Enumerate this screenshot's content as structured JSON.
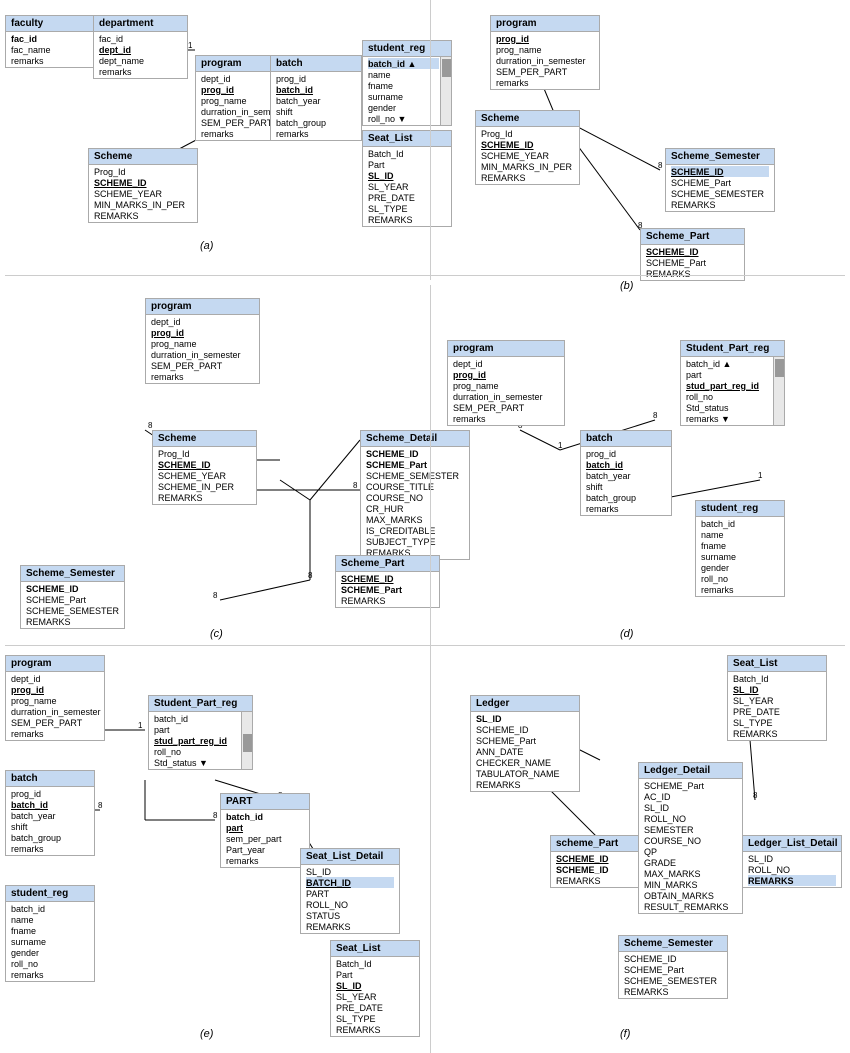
{
  "diagrams": {
    "a_label": "(a)",
    "b_label": "(b)",
    "c_label": "(c)",
    "d_label": "(d)",
    "e_label": "(e)",
    "f_label": "(f)"
  },
  "tables": {
    "faculty": {
      "header": "faculty",
      "fields": [
        "fac_id",
        "fac_name",
        "remarks"
      ]
    },
    "department_a": {
      "header": "department",
      "fields": [
        "fac_id",
        "dept_id",
        "dept_name",
        "remarks"
      ]
    },
    "program_a": {
      "header": "program",
      "fields": [
        "dept_id",
        "prog_id",
        "prog_name",
        "durration_in_semester",
        "SEM_PER_PART",
        "remarks"
      ]
    },
    "batch_a": {
      "header": "batch",
      "fields": [
        "prog_id",
        "batch_id",
        "batch_year",
        "shift",
        "batch_group",
        "remarks"
      ]
    },
    "scheme_a": {
      "header": "Scheme",
      "fields": [
        "Prog_Id",
        "SCHEME_ID",
        "SCHEME_YEAR",
        "MIN_MARKS_IN_PER",
        "REMARKS"
      ]
    },
    "student_reg_a": {
      "header": "student_reg",
      "fields": [
        "batch_id",
        "name",
        "fname",
        "surname",
        "gender",
        "roll_no"
      ]
    },
    "seat_list_a": {
      "header": "Seat_List",
      "fields": [
        "Batch_Id",
        "Part",
        "SL_ID",
        "SL_YEAR",
        "PRE_DATE",
        "SL_TYPE",
        "REMARKS"
      ]
    },
    "program_b": {
      "header": "program",
      "fields": [
        "prog_id",
        "prog_name",
        "durration_in_semester",
        "SEM_PER_PART",
        "remarks"
      ]
    },
    "scheme_b": {
      "header": "Scheme",
      "fields": [
        "Prog_Id",
        "SCHEME_ID",
        "SCHEME_YEAR",
        "MIN_MARKS_IN_PER",
        "REMARKS"
      ]
    },
    "scheme_part_b": {
      "header": "Scheme_Part",
      "fields": [
        "SCHEME_ID",
        "SCHEME_Part",
        "REMARKS"
      ]
    },
    "scheme_semester_b": {
      "header": "Scheme_Semester",
      "fields": [
        "SCHEME_ID",
        "SCHEME_Part",
        "SCHEME_SEMESTER",
        "REMARKS"
      ]
    },
    "program_c": {
      "header": "program",
      "fields": [
        "dept_id",
        "prog_id",
        "prog_name",
        "durration_in_semester",
        "SEM_PER_PART",
        "remarks"
      ]
    },
    "scheme_c": {
      "header": "Scheme",
      "fields": [
        "Prog_Id",
        "SCHEME_ID",
        "SCHEME_YEAR",
        "SCHEME_IN_PER",
        "REMARKS"
      ]
    },
    "scheme_detail_c": {
      "header": "Scheme_Detail",
      "fields": [
        "SCHEME_ID",
        "SCHEME_Part",
        "SCHEME_SEMESTER",
        "COURSE_TITLE",
        "COURSE_NO",
        "CR_HUR",
        "MAX_MARKS",
        "IS_CREDITABLE",
        "SUBJECT_TYPE",
        "REMARKS"
      ]
    },
    "scheme_part_c": {
      "header": "Scheme_Part",
      "fields": [
        "SCHEME_ID",
        "SCHEME_Part",
        "REMARKS"
      ]
    },
    "scheme_semester_c": {
      "header": "Scheme_Semester",
      "fields": [
        "SCHEME_ID",
        "SCHEME_Part",
        "SCHEME_SEMESTER",
        "REMARKS"
      ]
    },
    "program_d": {
      "header": "program",
      "fields": [
        "dept_id",
        "prog_id",
        "prog_name",
        "durration_in_semester",
        "SEM_PER_PART",
        "remarks"
      ]
    },
    "batch_d": {
      "header": "batch",
      "fields": [
        "prog_id",
        "batch_id",
        "batch_year",
        "shift",
        "batch_group",
        "remarks"
      ]
    },
    "student_part_reg_d": {
      "header": "Student_Part_reg",
      "fields": [
        "batch_id",
        "part",
        "stud_part_reg_id",
        "roll_no",
        "Std_status",
        "remarks"
      ]
    },
    "student_reg_d": {
      "header": "student_reg",
      "fields": [
        "batch_id",
        "name",
        "fname",
        "surname",
        "gender",
        "roll_no",
        "remarks"
      ]
    },
    "program_e": {
      "header": "program",
      "fields": [
        "dept_id",
        "prog_id",
        "prog_name",
        "durration_in_semester",
        "SEM_PER_PART",
        "remarks"
      ]
    },
    "batch_e": {
      "header": "batch",
      "fields": [
        "prog_id",
        "batch_id",
        "batch_year",
        "shift",
        "batch_group",
        "remarks"
      ]
    },
    "student_reg_e": {
      "header": "student_reg",
      "fields": [
        "batch_id",
        "name",
        "fname",
        "surname",
        "gender",
        "roll_no",
        "remarks"
      ]
    },
    "student_part_reg_e": {
      "header": "Student_Part_reg",
      "fields": [
        "batch_id",
        "part",
        "stud_part_reg_id",
        "roll_no",
        "Std_status"
      ]
    },
    "part_e": {
      "header": "PART",
      "fields": [
        "batch_id",
        "part",
        "sem_per_part",
        "Part_year",
        "remarks"
      ]
    },
    "seat_list_detail_e": {
      "header": "Seat_List_Detail",
      "fields": [
        "SL_ID",
        "BATCH_ID",
        "PART",
        "ROLL_NO",
        "STATUS",
        "REMARKS"
      ]
    },
    "seat_list_e": {
      "header": "Seat_List",
      "fields": [
        "Batch_Id",
        "Part",
        "SL_ID",
        "SL_YEAR",
        "PRE_DATE",
        "SL_TYPE",
        "REMARKS"
      ]
    },
    "ledger_f": {
      "header": "Ledger",
      "fields": [
        "SL_ID",
        "SCHEME_ID",
        "SCHEME_Part",
        "ANN_DATE",
        "CHECKER_NAME",
        "TABULATOR_NAME",
        "REMARKS"
      ]
    },
    "scheme_part_f": {
      "header": "scheme_Part",
      "fields": [
        "SCHEME_ID",
        "SCHEME_ID",
        "REMARKS"
      ]
    },
    "ledger_detail_f": {
      "header": "Ledger_Detail",
      "fields": [
        "SCHEME_Part",
        "AC_ID",
        "SL_ID",
        "ROLL_NO",
        "SEMESTER",
        "COURSE_NO",
        "QP",
        "GRADE",
        "MAX_MARKS",
        "MIN_MARKS",
        "OBTAIN_MARKS",
        "RESULT_REMARKS"
      ]
    },
    "seat_list_f": {
      "header": "Seat_List",
      "fields": [
        "Batch_Id",
        "SL_ID",
        "SL_YEAR",
        "PRE_DATE",
        "SL_TYPE",
        "REMARKS"
      ]
    },
    "ledger_list_detail_f": {
      "header": "Ledger_List_Detail",
      "fields": [
        "SL_ID",
        "ROLL_NO",
        "REMARKS"
      ]
    },
    "scheme_semester_f": {
      "header": "Scheme_Semester",
      "fields": [
        "SCHEME_ID",
        "SCHEME_Part",
        "SCHEME_SEMESTER",
        "REMARKS"
      ]
    }
  }
}
